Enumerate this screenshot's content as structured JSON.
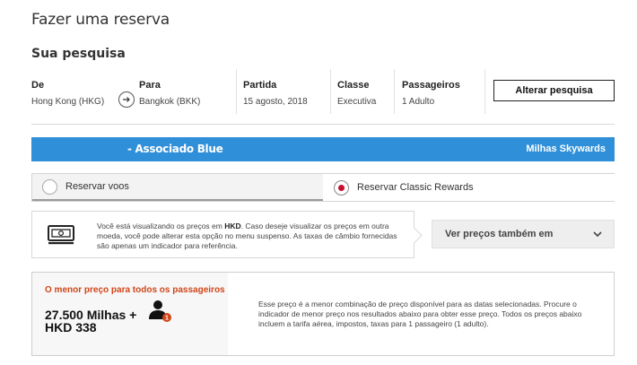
{
  "page_title": "Fazer uma reserva",
  "search": {
    "section_title": "Sua pesquisa",
    "from": {
      "label": "De",
      "value": "Hong Kong (HKG)"
    },
    "to": {
      "label": "Para",
      "value": "Bangkok (BKK)"
    },
    "departure": {
      "label": "Partida",
      "value": "15 agosto, 2018"
    },
    "class": {
      "label": "Classe",
      "value": "Executiva"
    },
    "passengers": {
      "label": "Passageiros",
      "value": "1 Adulto"
    },
    "alter_button": "Alterar pesquisa"
  },
  "member_bar": {
    "tier": "- Associado Blue",
    "miles_label": "Milhas Skywards",
    "color": "#2f8fd8"
  },
  "booking_toggle": {
    "options": [
      {
        "label": "Reservar voos",
        "selected": false
      },
      {
        "label": "Reservar Classic Rewards",
        "selected": true
      }
    ],
    "accent": "#c8102e"
  },
  "currency_notice": {
    "icon": "banknote-screen-icon",
    "prefix": "Você está visualizando os preços em ",
    "currency": "HKD",
    "suffix": ". Caso deseje visualizar os preços em outra moeda, você pode alterar esta opção no menu suspenso. As taxas de câmbio fornecidas são apenas um indicador para referência.",
    "select_label": "Ver preços também em"
  },
  "lowest_price": {
    "label": "O menor preço para todos os passageiros",
    "price_line1": "27.500 Milhas +",
    "price_line2": "HKD 338",
    "passenger_count": "1",
    "description": "Esse preço é a menor combinação de preço disponível para as datas selecionadas. Procure o indicador de menor preço nos resultados abaixo para obter esse preço. Todos os preços abaixo incluem a tarifa aérea, impostos, taxas para 1 passageiro (1 adulto).",
    "label_color": "#d0461a"
  }
}
